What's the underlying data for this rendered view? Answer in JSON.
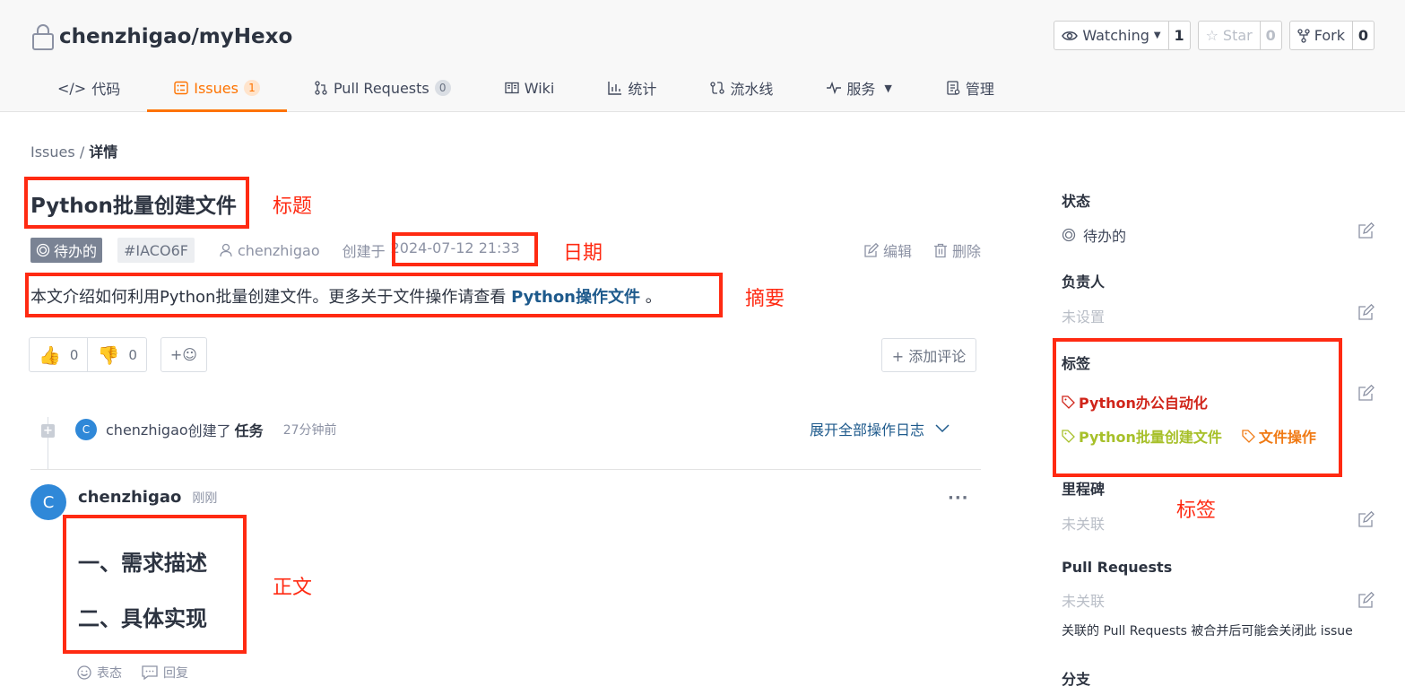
{
  "repo": {
    "name": "chenzhigao/myHexo"
  },
  "actions": {
    "watch_label": "Watching",
    "watch_count": "1",
    "star_label": "Star",
    "star_count": "0",
    "fork_label": "Fork",
    "fork_count": "0"
  },
  "tabs": [
    {
      "label": "代码",
      "icon": "code-icon"
    },
    {
      "label": "Issues",
      "badge": "1",
      "icon": "issues-icon",
      "active": true
    },
    {
      "label": "Pull Requests",
      "badge": "0",
      "icon": "pull-request-icon"
    },
    {
      "label": "Wiki",
      "icon": "book-icon"
    },
    {
      "label": "统计",
      "icon": "chart-icon"
    },
    {
      "label": "流水线",
      "icon": "pipeline-icon"
    },
    {
      "label": "服务",
      "icon": "pulse-icon"
    },
    {
      "label": "管理",
      "icon": "settings-doc-icon"
    }
  ],
  "breadcrumb": {
    "root": "Issues",
    "separator": "/",
    "current": "详情"
  },
  "issue": {
    "title": "Python批量创建文件",
    "state": "待办的",
    "id": "#IACO6F",
    "author": "chenzhigao",
    "created_label": "创建于",
    "created_at": "2024-07-12 21:33",
    "edit_label": "编辑",
    "delete_label": "删除",
    "summary_prefix": "本文介绍如何利用Python批量创建文件。更多关于文件操作请查看",
    "summary_link": "Python操作文件",
    "summary_suffix": "。"
  },
  "reactions": {
    "thumbs_up": "0",
    "thumbs_down": "0",
    "add_emoji": "+☺"
  },
  "add_comment_label": "+ 添加评论",
  "timeline": {
    "avatar_letter": "C",
    "actor": "chenzhigao",
    "action_prefix": "创建了",
    "action_object": "任务",
    "time": "27分钟前",
    "expand_label": "展开全部操作日志"
  },
  "comment": {
    "avatar_letter": "C",
    "author": "chenzhigao",
    "time": "刚刚",
    "more": "···",
    "heading1": "一、需求描述",
    "heading2": "二、具体实现",
    "react_label": "表态",
    "reply_label": "回复"
  },
  "sidebar": {
    "state_label": "状态",
    "state_value": "待办的",
    "assignee_label": "负责人",
    "assignee_value": "未设置",
    "labels_label": "标签",
    "labels": [
      {
        "text": "Python办公自动化",
        "color": "#d0251a"
      },
      {
        "text": "Python批量创建文件",
        "color": "#a7c02a"
      },
      {
        "text": "文件操作",
        "color": "#f07a14"
      }
    ],
    "milestone_label": "里程碑",
    "milestone_value": "未关联",
    "pr_label": "Pull Requests",
    "pr_value": "未关联",
    "pr_note": "关联的 Pull Requests 被合并后可能会关闭此 issue",
    "branch_label": "分支"
  },
  "annotations": {
    "title": "标题",
    "date": "日期",
    "summary": "摘要",
    "body": "正文",
    "labels": "标签"
  },
  "colors": {
    "accent": "#fe7300",
    "annotation": "#ff2a12",
    "link": "#1e5a8c"
  }
}
